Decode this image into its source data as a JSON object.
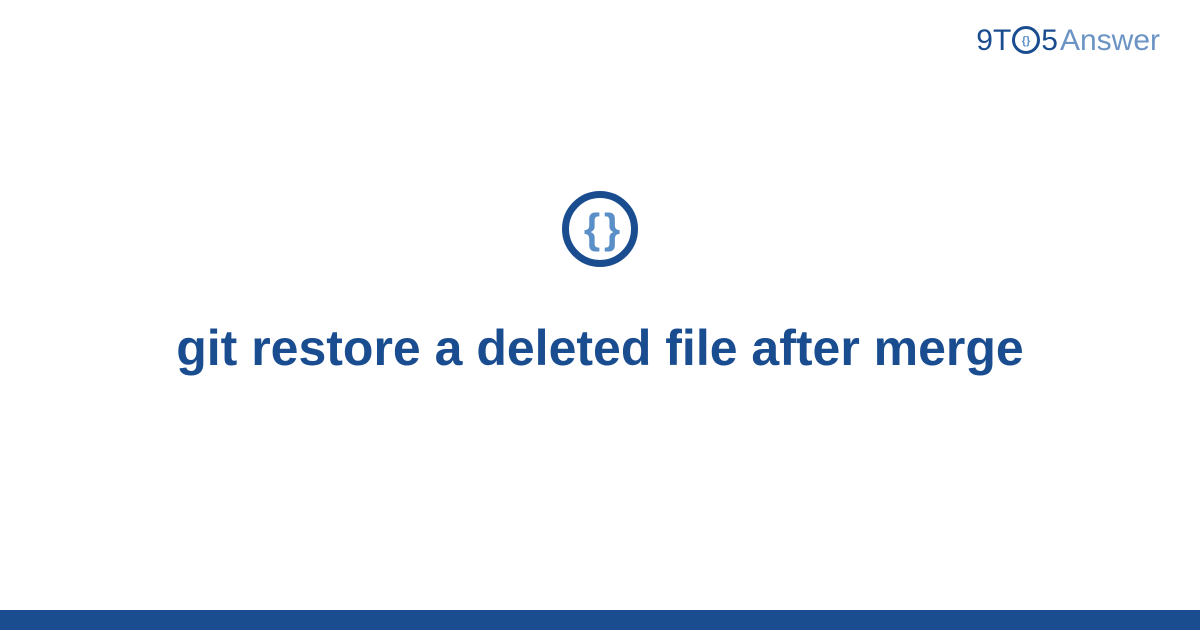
{
  "brand": {
    "part1": "9",
    "part2": "T",
    "part3": "5",
    "part4": "Answer"
  },
  "main": {
    "title": "git restore a deleted file after merge"
  },
  "colors": {
    "primary": "#1a4d8f",
    "secondary": "#5a8fc7",
    "light": "#6b94c4"
  }
}
